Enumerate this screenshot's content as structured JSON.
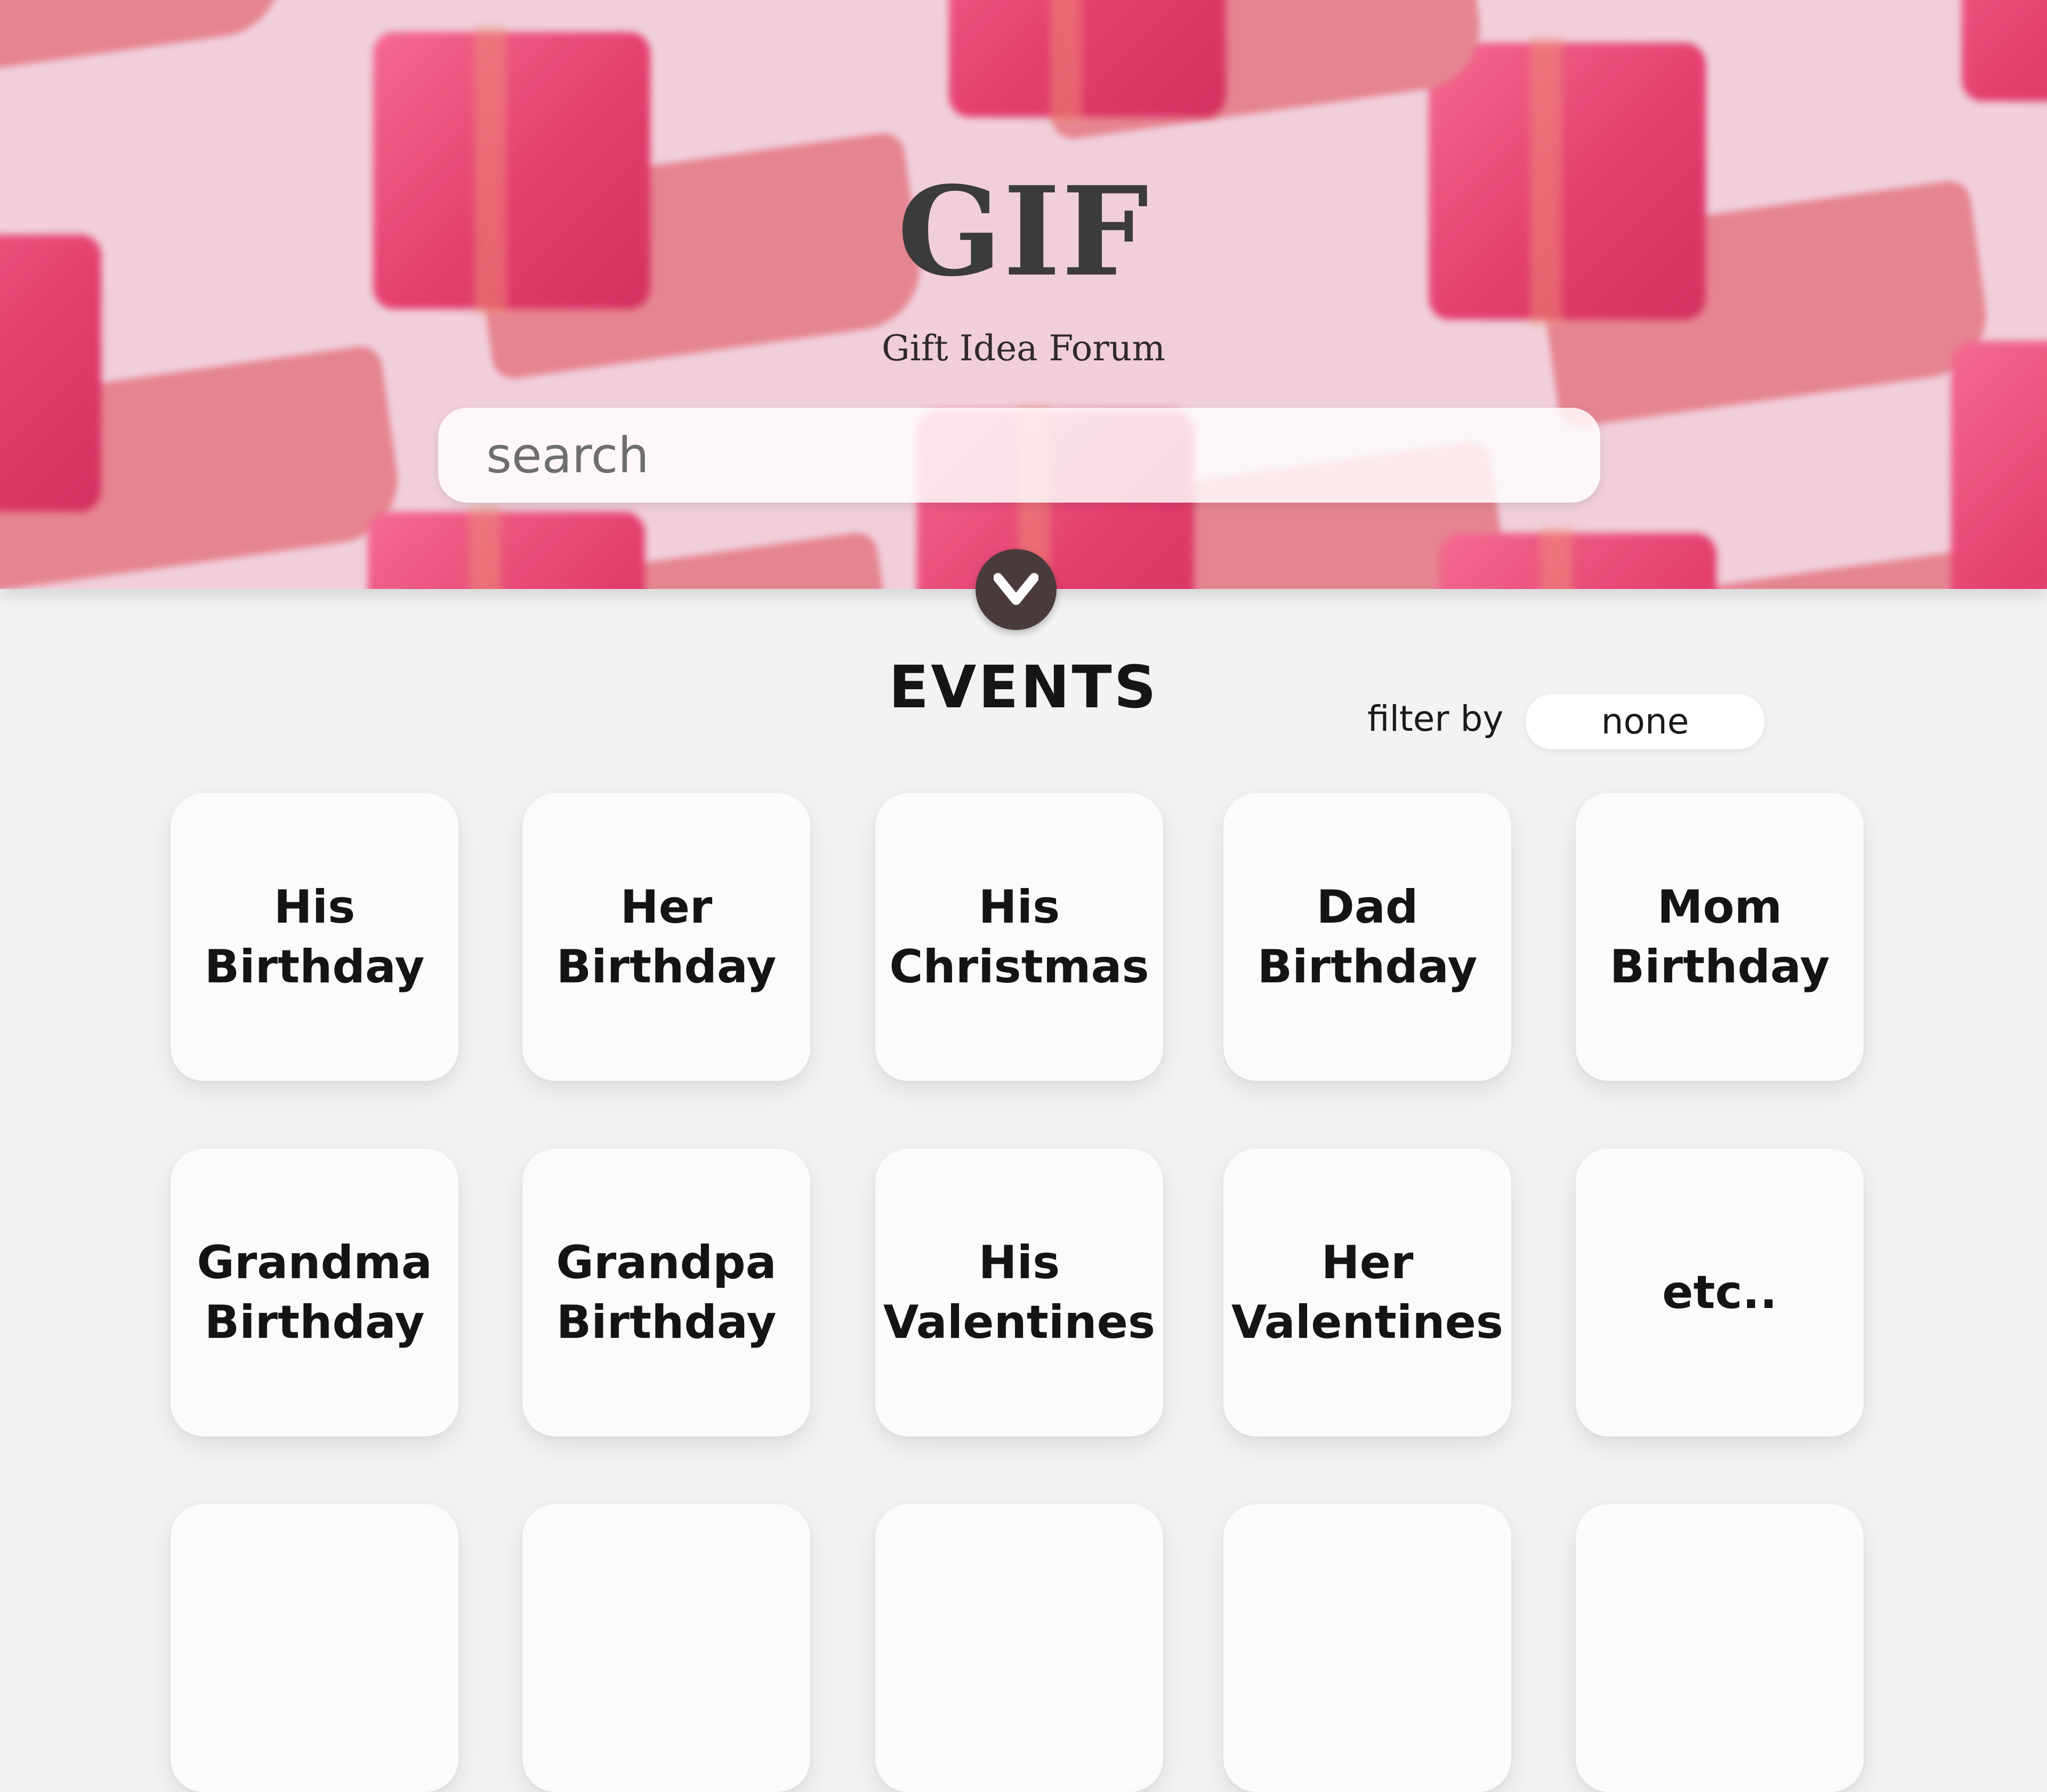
{
  "brand": {
    "title": "GIF",
    "subtitle": "Gift Idea Forum"
  },
  "search": {
    "placeholder": "search",
    "value": ""
  },
  "scroll_button": {
    "icon": "chevron-down-icon"
  },
  "events": {
    "heading": "EVENTS",
    "filter_label": "filter by",
    "filter_value": "none",
    "cards": [
      "His\nBirthday",
      "Her\nBirthday",
      "His\nChristmas",
      "Dad\nBirthday",
      "Mom\nBirthday",
      "Grandma\nBirthday",
      "Grandpa\nBirthday",
      "His\nValentines",
      "Her\nValentines",
      "etc..",
      "",
      "",
      "",
      "",
      ""
    ]
  },
  "colors": {
    "hero_background": "#f0cfda",
    "gift": "#e43f6f",
    "chevron_button": "#4a3a3c",
    "page_background": "#f3f3f3",
    "card_background": "#fbfbfb"
  }
}
